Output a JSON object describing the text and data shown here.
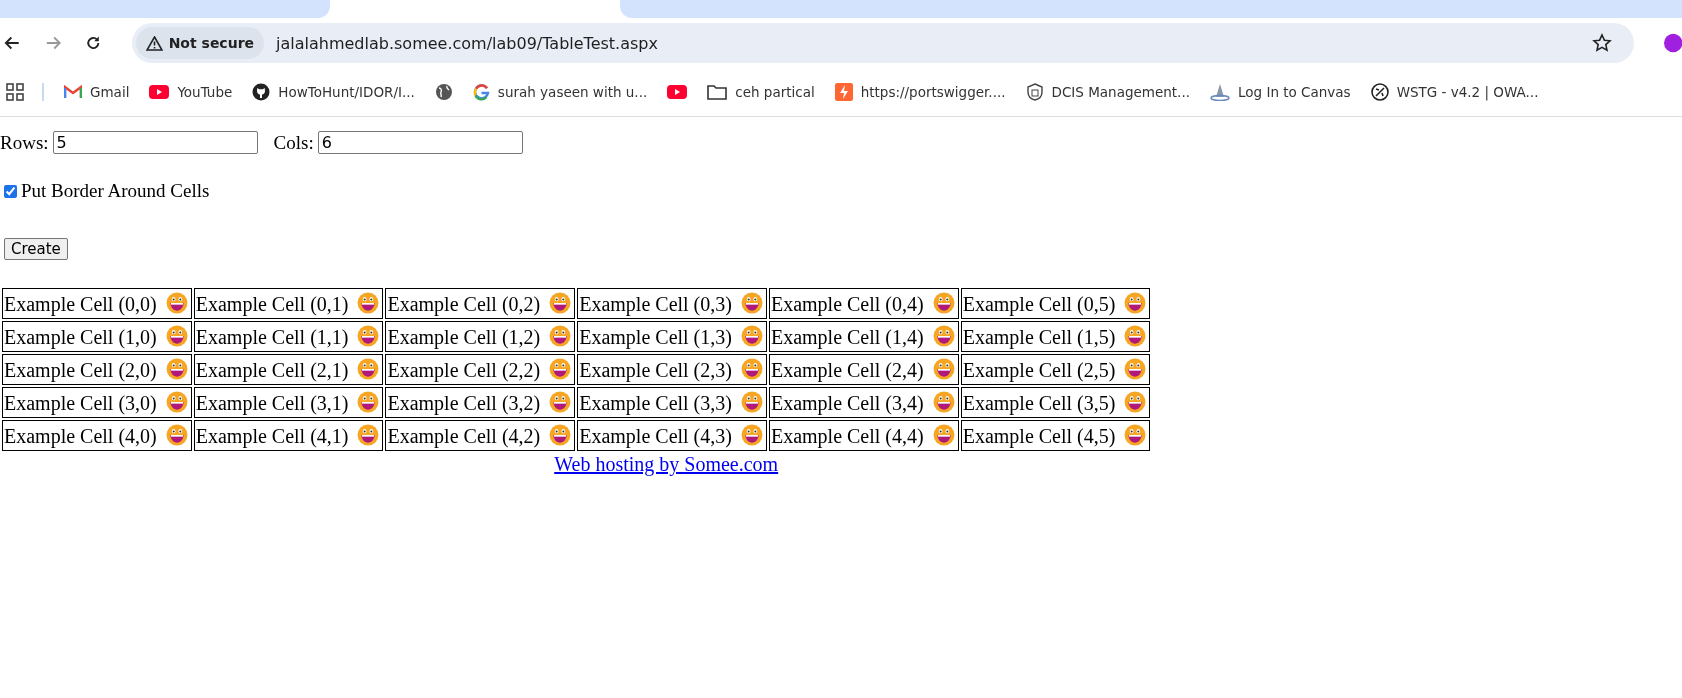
{
  "browser": {
    "security_label": "Not secure",
    "url": "jalalahmedlab.somee.com/lab09/TableTest.aspx"
  },
  "bookmarks": [
    {
      "label": "Gmail",
      "kind": "gmail"
    },
    {
      "label": "YouTube",
      "kind": "youtube"
    },
    {
      "label": "HowToHunt/IDOR/I...",
      "kind": "github"
    },
    {
      "kind": "globe"
    },
    {
      "label": "surah yaseen with u...",
      "kind": "google"
    },
    {
      "kind": "youtube"
    },
    {
      "label": "ceh partical",
      "kind": "folder"
    },
    {
      "label": "https://portswigger....",
      "kind": "portswigger"
    },
    {
      "label": "DCIS Management...",
      "kind": "shield"
    },
    {
      "label": "Log In to Canvas",
      "kind": "canvas"
    },
    {
      "label": "WSTG - v4.2 | OWA...",
      "kind": "owasp"
    }
  ],
  "form": {
    "rows_label": "Rows:",
    "rows_value": "5",
    "cols_label": "Cols:",
    "cols_value": "6",
    "border_label": "Put Border Around Cells",
    "border_checked": true,
    "create_button": "Create"
  },
  "table": {
    "rows": [
      [
        "Example Cell (0,0)",
        "Example Cell (0,1)",
        "Example Cell (0,2)",
        "Example Cell (0,3)",
        "Example Cell (0,4)",
        "Example Cell (0,5)"
      ],
      [
        "Example Cell (1,0)",
        "Example Cell (1,1)",
        "Example Cell (1,2)",
        "Example Cell (1,3)",
        "Example Cell (1,4)",
        "Example Cell (1,5)"
      ],
      [
        "Example Cell (2,0)",
        "Example Cell (2,1)",
        "Example Cell (2,2)",
        "Example Cell (2,3)",
        "Example Cell (2,4)",
        "Example Cell (2,5)"
      ],
      [
        "Example Cell (3,0)",
        "Example Cell (3,1)",
        "Example Cell (3,2)",
        "Example Cell (3,3)",
        "Example Cell (3,4)",
        "Example Cell (3,5)"
      ],
      [
        "Example Cell (4,0)",
        "Example Cell (4,1)",
        "Example Cell (4,2)",
        "Example Cell (4,3)",
        "Example Cell (4,4)",
        "Example Cell (4,5)"
      ]
    ]
  },
  "footer_link": "Web hosting by Somee.com"
}
